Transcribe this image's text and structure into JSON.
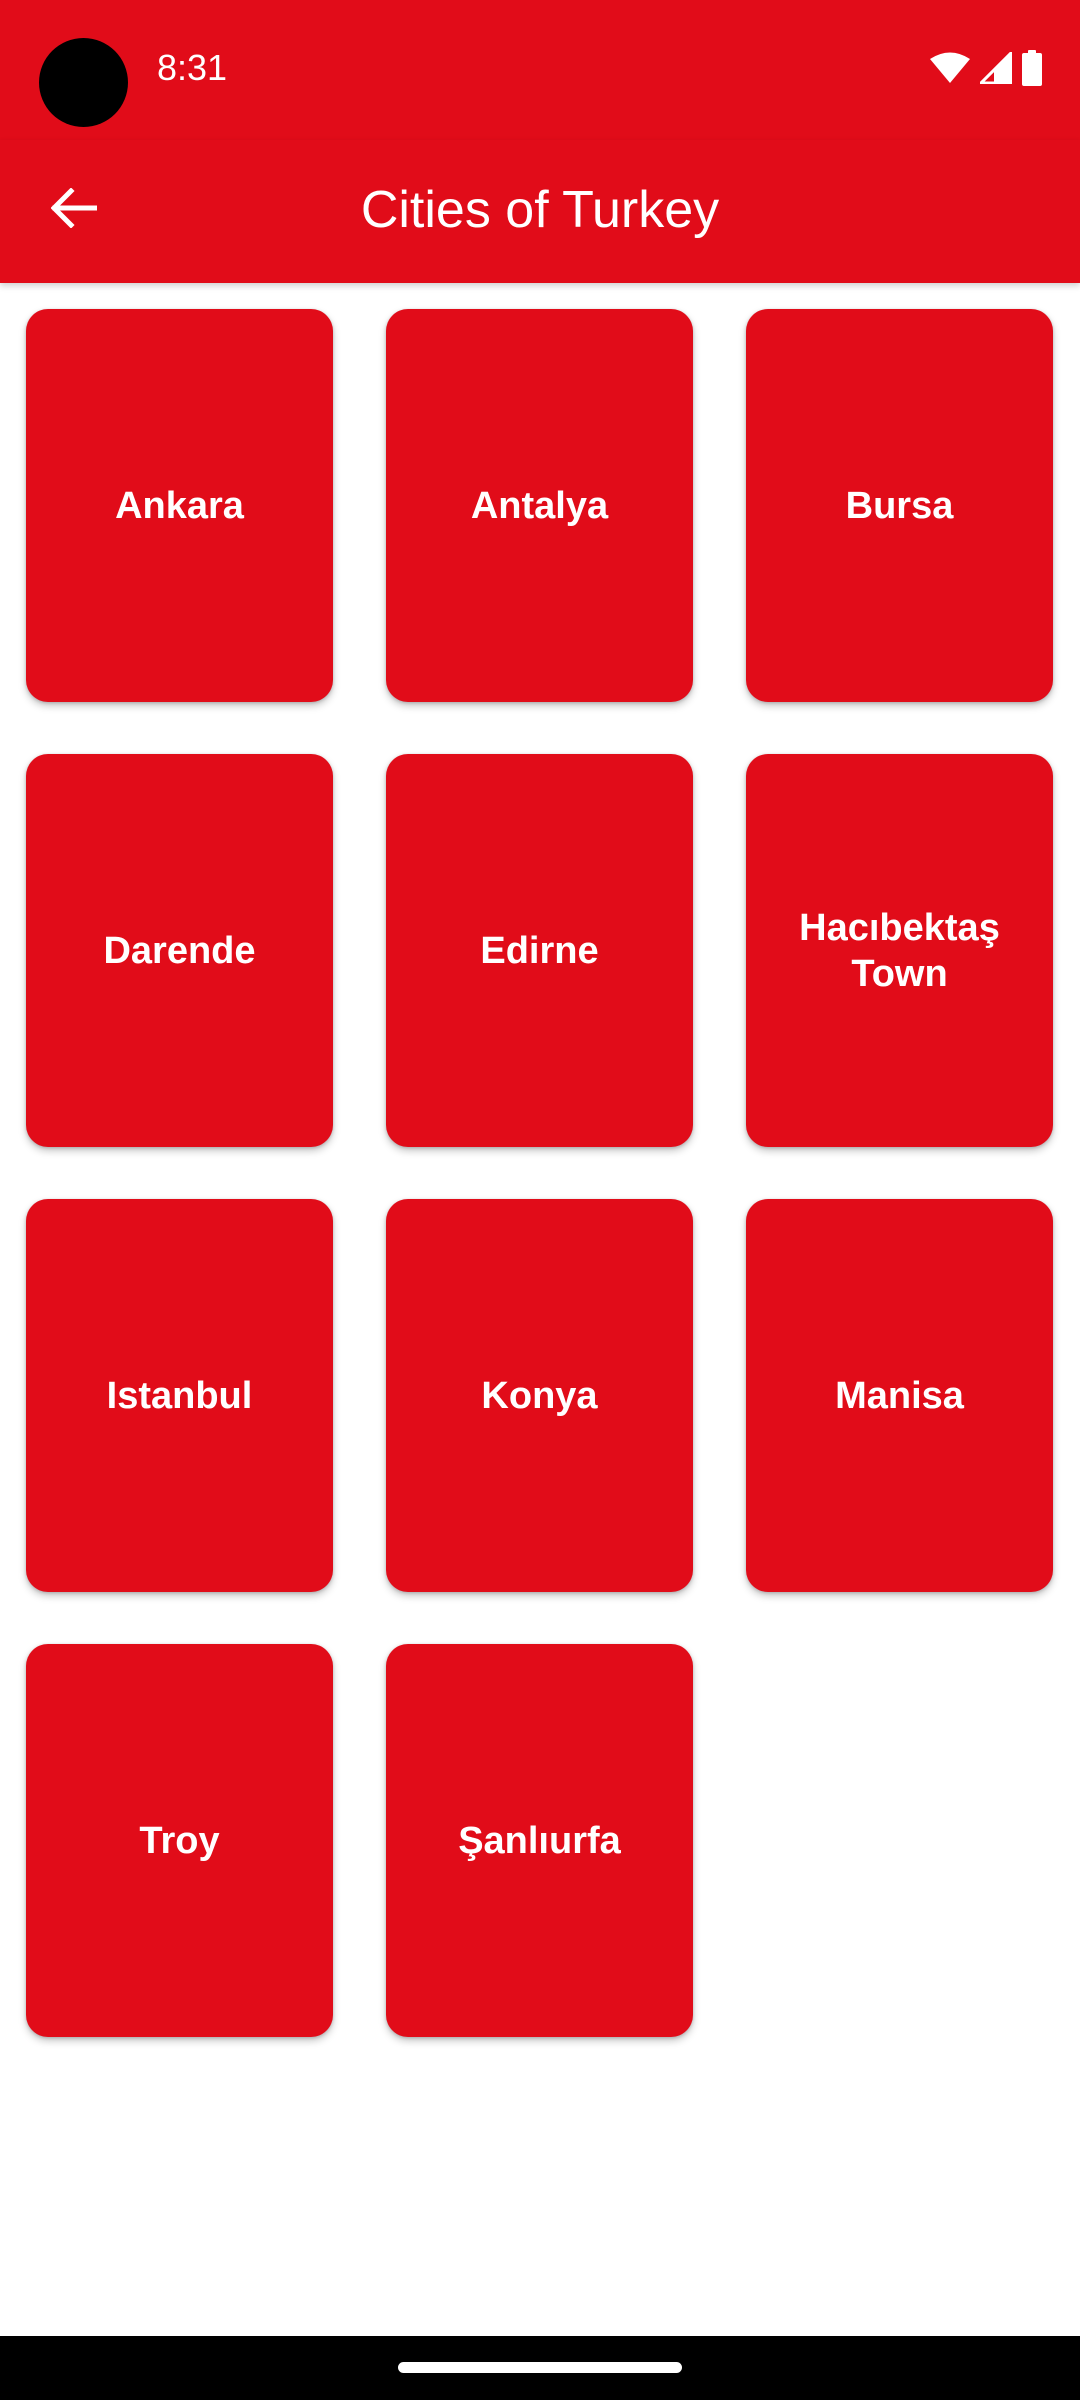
{
  "status_bar": {
    "time": "8:31",
    "icons": [
      "wifi-icon",
      "signal-icon",
      "battery-icon"
    ]
  },
  "app_bar": {
    "back_icon": "arrow-left-icon",
    "title": "Cities of Turkey"
  },
  "cities": [
    {
      "label": "Ankara"
    },
    {
      "label": "Antalya"
    },
    {
      "label": "Bursa"
    },
    {
      "label": "Darende"
    },
    {
      "label": "Edirne"
    },
    {
      "label": "Hacıbektaş Town"
    },
    {
      "label": "Istanbul"
    },
    {
      "label": "Konya"
    },
    {
      "label": "Manisa"
    },
    {
      "label": "Troy"
    },
    {
      "label": "Şanlıurfa"
    }
  ],
  "colors": {
    "primary": "#e10c19",
    "on_primary": "#ffffff",
    "background": "#ffffff"
  }
}
